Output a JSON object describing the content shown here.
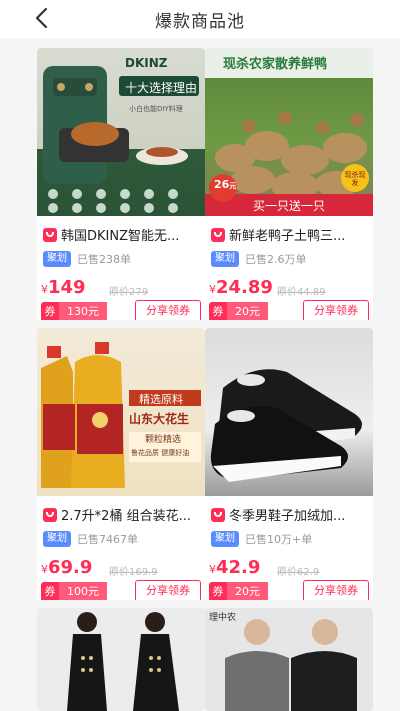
{
  "header": {
    "title": "爆款商品池"
  },
  "products": [
    {
      "name": "韩国DKINZ智能无...",
      "source": "聚划",
      "sold": "已售238单",
      "price": "149",
      "original": "原价279",
      "coupon_label": "券",
      "coupon_value": "130元",
      "share": "分享领券",
      "image": {
        "brand": "DKINZ",
        "headline": "十大选择理由",
        "subline": "小白也能DIY料理"
      }
    },
    {
      "name": "新鲜老鸭子土鸭三...",
      "source": "聚划",
      "sold": "已售2.6万单",
      "price": "24.89",
      "original": "原价44.89",
      "coupon_label": "券",
      "coupon_value": "20元",
      "share": "分享领券",
      "image": {
        "headline": "现杀农家散养鲜鸭",
        "badge": "26",
        "badge_sub": "元",
        "footer": "买一只送一只",
        "stamp": "现杀现发"
      }
    },
    {
      "name": "2.7升*2桶 组合装花...",
      "source": "聚划",
      "sold": "已售7467单",
      "price": "69.9",
      "original": "原价169.9",
      "coupon_label": "券",
      "coupon_value": "100元",
      "share": "分享领券",
      "image": {
        "banner": "精选原料",
        "big": "山东大花生",
        "small": "颗粒精选",
        "note": "鲁花品质 健康好油"
      }
    },
    {
      "name": "冬季男鞋子加绒加...",
      "source": "聚划",
      "sold": "已售10万+单",
      "price": "42.9",
      "original": "原价62.9",
      "coupon_label": "券",
      "coupon_value": "20元",
      "share": "分享领券"
    },
    {
      "image": {
        "kind": "dress"
      }
    },
    {
      "image": {
        "brand": "理中农",
        "kind": "thermal"
      }
    }
  ],
  "currency": "¥",
  "colors": {
    "accent": "#ff2d55",
    "source_badge": "#5b8cff"
  }
}
